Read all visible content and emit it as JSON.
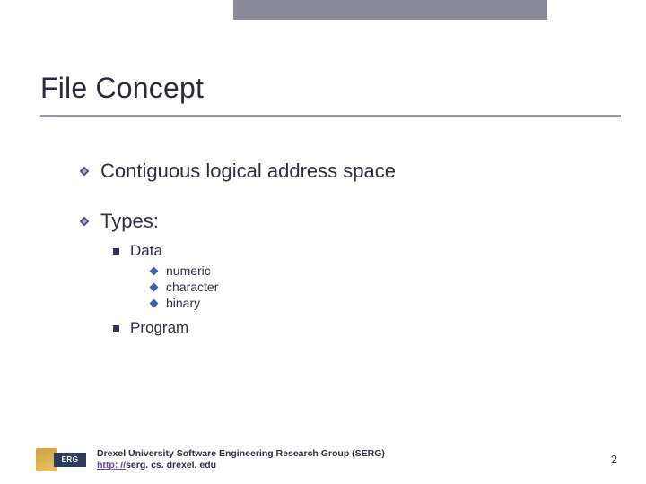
{
  "title": "File Concept",
  "bullets": {
    "contiguous": "Contiguous logical address space",
    "types": "Types:",
    "data": "Data",
    "numeric": "numeric",
    "character": "character",
    "binary": "binary",
    "program": "Program"
  },
  "footer": {
    "org": "Drexel University Software Engineering Research Group (SERG)",
    "link_prefix": "http: //",
    "link_rest": "serg. cs. drexel. edu"
  },
  "logo_text": "ERG",
  "page_number": "2"
}
